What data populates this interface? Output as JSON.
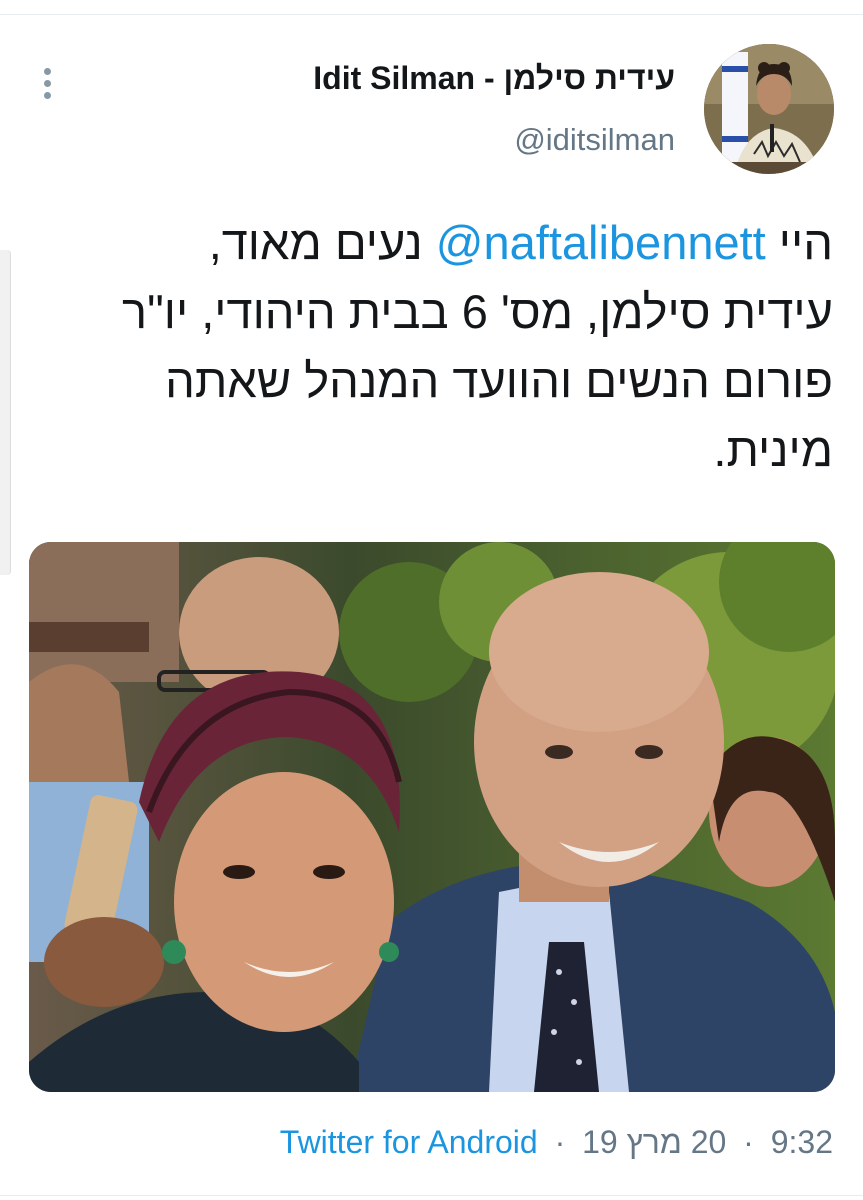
{
  "tweet": {
    "display_name": "Idit Silman - עידית סילמן",
    "handle": "@iditsilman",
    "text_line_1_pre": "היי ",
    "text_mention": "@naftalibennett",
    "text_line_1_post": " נעים מאוד,",
    "text_line_2": "עידית סילמן, מס' 6 בבית היהודי, יו\"ר",
    "text_line_3": "פורום הנשים והוועד המנהל שאתה",
    "text_line_4": "מינית.",
    "time": "9:32",
    "date": "20 מרץ 19",
    "separator": "·",
    "source": "Twitter for Android"
  },
  "icons": {
    "more": "more-vertical-icon"
  },
  "colors": {
    "link": "#1b95e0",
    "secondary_text": "#657786",
    "primary_text": "#14171a"
  }
}
